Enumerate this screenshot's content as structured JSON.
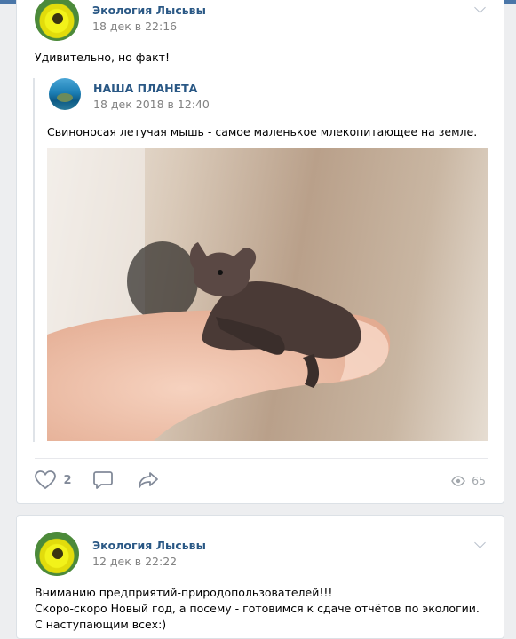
{
  "colors": {
    "accent": "#4a76a8",
    "link": "#2a5885",
    "muted": "#828282",
    "background": "#edeef0"
  },
  "posts": [
    {
      "author": "Экология Лысьвы",
      "date": "18 дек в 22:16",
      "text": "Удивительно, но факт!",
      "repost": {
        "author": "НАША ПЛАНЕТА",
        "date": "18 дек 2018 в 12:40",
        "text": "Свиноносая летучая мышь - самое маленькое млекопитающее на земле."
      },
      "actions": {
        "likes": "2",
        "views": "65"
      }
    },
    {
      "author": "Экология Лысьвы",
      "date": "12 дек в 22:22",
      "lines": [
        "Вниманию предприятий-природопользователей!!!",
        "Скоро-скоро Новый год, а посему - готовимся к сдаче отчётов по экологии.",
        "С наступающим всех:)"
      ]
    }
  ]
}
